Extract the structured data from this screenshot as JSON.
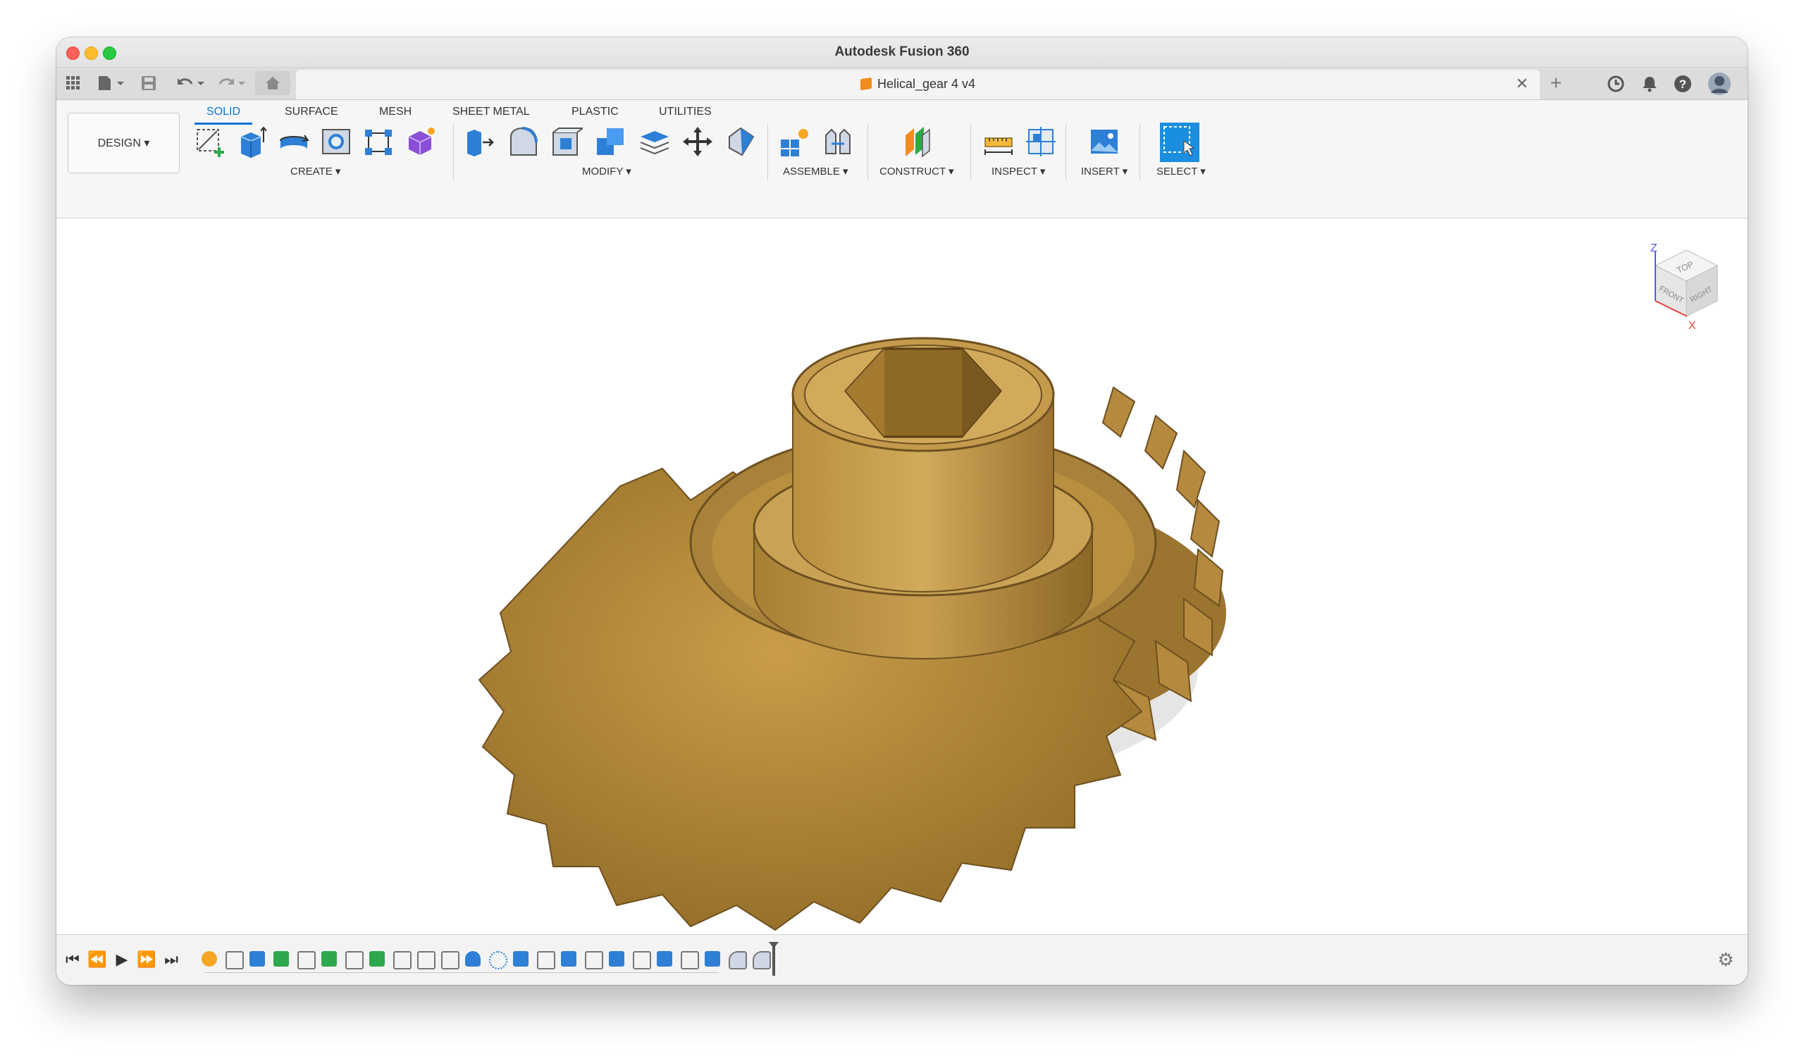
{
  "window": {
    "title": "Autodesk Fusion 360"
  },
  "document_tab": {
    "title": "Helical_gear 4 v4"
  },
  "workspace": {
    "label": "DESIGN ▾"
  },
  "tabs": [
    "SOLID",
    "SURFACE",
    "MESH",
    "SHEET METAL",
    "PLASTIC",
    "UTILITIES"
  ],
  "active_tab": "SOLID",
  "groups": {
    "create": "CREATE ▾",
    "modify": "MODIFY ▾",
    "assemble": "ASSEMBLE ▾",
    "construct": "CONSTRUCT ▾",
    "inspect": "INSPECT ▾",
    "insert": "INSERT ▾",
    "select": "SELECT ▾"
  },
  "viewcube": {
    "top": "TOP",
    "front": "FRONT",
    "right": "RIGHT",
    "z": "Z",
    "x": "X"
  },
  "colors": {
    "accent": "#0b73d9",
    "gear": "#b58a3e",
    "select_bg": "#1a8fe0"
  }
}
